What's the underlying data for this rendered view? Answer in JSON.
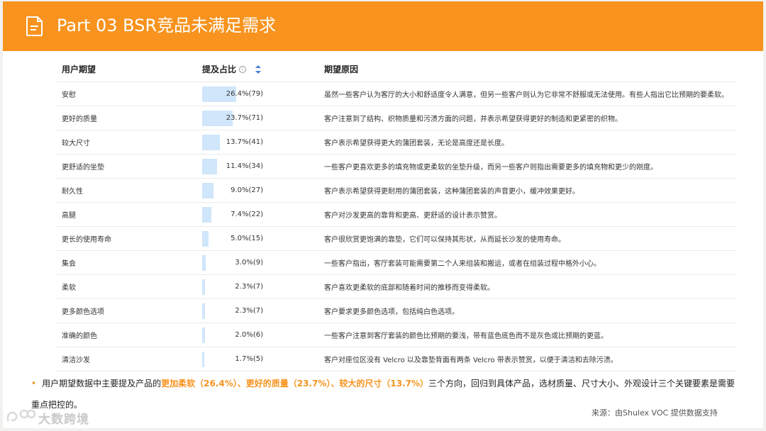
{
  "header": {
    "title": "Part 03  BSR竞品未满足需求",
    "icon": "document-icon",
    "color": "#f7931e"
  },
  "table": {
    "columns": {
      "need": "用户期望",
      "pct": "提及占比",
      "reason": "期望原因"
    },
    "bar_color": "#cfe6fb",
    "rows": [
      {
        "need": "安慰",
        "pct_text": "26.4%(79)",
        "pct": 26.4,
        "reason": "虽然一些客户认为客厅的大小和舒适度令人满意，但另一些客户则认为它非常不舒服或无法使用。有些人指出它比预期的要柔软。"
      },
      {
        "need": "更好的质量",
        "pct_text": "23.7%(71)",
        "pct": 23.7,
        "reason": "客户注意到了结构、织物质量和污渍方面的问题，并表示希望获得更好的制造和更紧密的织物。"
      },
      {
        "need": "较大尺寸",
        "pct_text": "13.7%(41)",
        "pct": 13.7,
        "reason": "客户表示希望获得更大的蒲团套装，无论是高度还是长度。"
      },
      {
        "need": "更舒适的坐垫",
        "pct_text": "11.4%(34)",
        "pct": 11.4,
        "reason": "一些客户更喜欢更多的填充物或更柔软的坐垫升级，而另一些客户则指出需要更多的填充物和更少的刚度。"
      },
      {
        "need": "耐久性",
        "pct_text": "9.0%(27)",
        "pct": 9.0,
        "reason": "客户表示希望获得更耐用的蒲团套装，这种蒲团套装的声音更小，缓冲效果更好。"
      },
      {
        "need": "高腿",
        "pct_text": "7.4%(22)",
        "pct": 7.4,
        "reason": "客户对沙发更高的靠背和更高、更舒适的设计表示赞赏。"
      },
      {
        "need": "更长的使用寿命",
        "pct_text": "5.0%(15)",
        "pct": 5.0,
        "reason": "客户很欣赏更饱满的靠垫，它们可以保持其形状，从而延长沙发的使用寿命。"
      },
      {
        "need": "集会",
        "pct_text": "3.0%(9)",
        "pct": 3.0,
        "reason": "一些客户指出，客厅套装可能需要第二个人来组装和搬运，或者在组装过程中格外小心。"
      },
      {
        "need": "柔软",
        "pct_text": "2.3%(7)",
        "pct": 2.3,
        "reason": "客户喜欢更柔软的底部和随着时间的推移而变得柔软。"
      },
      {
        "need": "更多颜色选项",
        "pct_text": "2.3%(7)",
        "pct": 2.3,
        "reason": "客户要求更多颜色选项，包括纯白色选项。"
      },
      {
        "need": "准确的颜色",
        "pct_text": "2.0%(6)",
        "pct": 2.0,
        "reason": "一些客户注意到客厅套装的颜色比预期的要浅，带有蓝色底色而不是灰色或比预期的更蓝。"
      },
      {
        "need": "清洁沙发",
        "pct_text": "1.7%(5)",
        "pct": 1.7,
        "reason": "客户对座位区没有 Velcro 以及靠垫背面有两条 Velcro 带表示赞赏，以便于清洁和去除污渍。"
      }
    ]
  },
  "summary": {
    "prefix": "用户期望数据中主要提及产品的",
    "highlight": "更加柔软（26.4%）、更好的质量（23.7%）、较大的尺寸（13.7%）",
    "suffix": "三个方向，回归到具体产品，选材质量、尺寸大小、外观设计三个关键要素是需要重点把控的。"
  },
  "source": "来源：由Shulex VOC 提供数据支持",
  "logo": {
    "text": "大数跨境",
    "icon": "logo-icon"
  }
}
